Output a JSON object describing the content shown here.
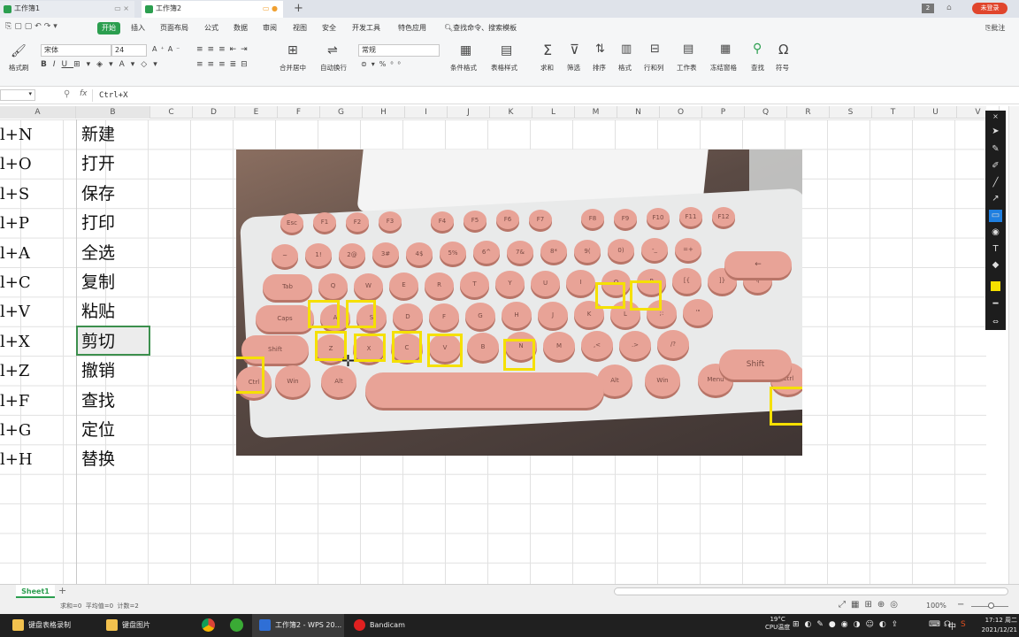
{
  "tabs": [
    {
      "label": "工作簿1"
    },
    {
      "label": "工作簿2"
    }
  ],
  "titlebar": {
    "page_badge": "2",
    "login_label": "未登录"
  },
  "menu": [
    "开始",
    "插入",
    "页面布局",
    "公式",
    "数据",
    "审阅",
    "视图",
    "安全",
    "开发工具",
    "特色应用"
  ],
  "search_cmd": "查找命令、搜索模板",
  "annotate": "批注",
  "ribbon": {
    "format_painter": "格式刷",
    "font_name": "宋体",
    "font_size": "24",
    "merge_center": "合并居中",
    "wrap_text": "自动换行",
    "number_format": "常规",
    "conditional_format": "条件格式",
    "table_style": "表格样式",
    "sum": "求和",
    "filter": "筛选",
    "sort": "排序",
    "format": "格式",
    "row_col": "行和列",
    "worksheet": "工作表",
    "freeze": "冻结窗格",
    "find": "查找",
    "symbol": "符号"
  },
  "formula": {
    "fx": "fx",
    "value": "Ctrl+X"
  },
  "columns": [
    "A",
    "B",
    "C",
    "D",
    "E",
    "F",
    "G",
    "H",
    "I",
    "J",
    "K",
    "L",
    "M",
    "N",
    "O",
    "P",
    "Q",
    "R",
    "S",
    "T",
    "U",
    "V"
  ],
  "shortcuts": [
    {
      "key": "l+N",
      "action": "新建"
    },
    {
      "key": "l+O",
      "action": "打开"
    },
    {
      "key": "l+S",
      "action": "保存"
    },
    {
      "key": "l+P",
      "action": "打印"
    },
    {
      "key": "l+A",
      "action": "全选"
    },
    {
      "key": "l+C",
      "action": "复制"
    },
    {
      "key": "l+V",
      "action": "粘贴"
    },
    {
      "key": "l+X",
      "action": "剪切"
    },
    {
      "key": "l+Z",
      "action": "撤销"
    },
    {
      "key": "l+F",
      "action": "查找"
    },
    {
      "key": "l+G",
      "action": "定位"
    },
    {
      "key": "l+H",
      "action": "替换"
    }
  ],
  "keyboard": {
    "row1": [
      "Esc",
      "F1",
      "F2",
      "F3",
      "F4",
      "F5",
      "F6",
      "F7",
      "F8",
      "F9",
      "F10",
      "F11",
      "F12"
    ],
    "row2": [
      "~",
      "1!",
      "2@",
      "3#",
      "4$",
      "5%",
      "6^",
      "7&",
      "8*",
      "9(",
      "0)",
      "-_",
      "=+"
    ],
    "row3": [
      "Tab",
      "Q",
      "W",
      "E",
      "R",
      "T",
      "Y",
      "U",
      "I",
      "O",
      "P",
      "[{",
      "]}",
      "\\|"
    ],
    "row4": [
      "Caps",
      "A",
      "S",
      "D",
      "F",
      "G",
      "H",
      "J",
      "K",
      "L",
      ";:",
      "'\""
    ],
    "row5": [
      "Shift",
      "Z",
      "X",
      "C",
      "V",
      "B",
      "N",
      "M",
      ",<",
      ".>",
      "/?",
      "Shift"
    ],
    "row6": [
      "Ctrl",
      "Win",
      "Alt",
      "Alt",
      "Win",
      "Menu",
      "Ctrl"
    ],
    "backspace": "←"
  },
  "sheet": {
    "name": "Sheet1"
  },
  "status": {
    "text": "求和=0  平均值=0  计数=2",
    "zoom": "100%"
  },
  "taskbar": {
    "items": [
      "键盘表格录制",
      "键盘图片",
      "工作簿2 - WPS 20...",
      "Bandicam"
    ],
    "temp": "19°C",
    "cpu": "CPU温度",
    "ime": "中",
    "time": "17:12 周二",
    "date": "2021/12/21"
  }
}
